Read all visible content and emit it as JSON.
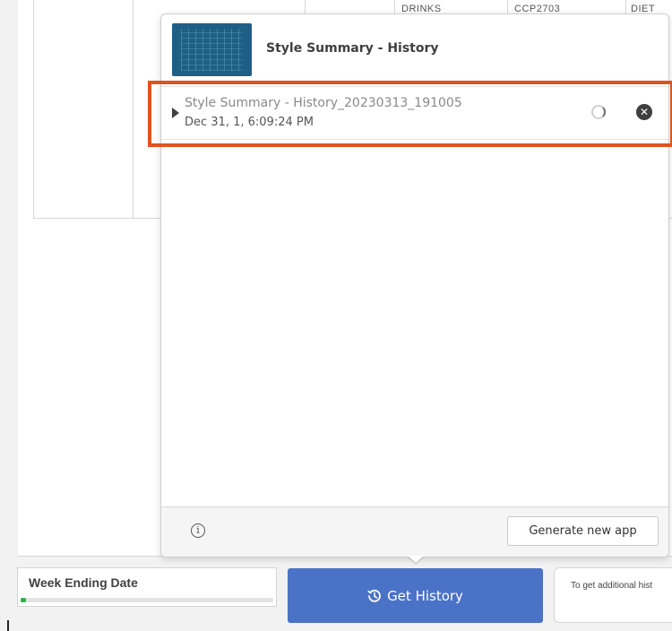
{
  "background_table": {
    "cells": [
      "DRINKS",
      "CCP2703",
      "DIET"
    ]
  },
  "popover": {
    "app_title": "Style Summary - History",
    "history_item": {
      "name": "Style Summary - History_20230313_191005",
      "date": "Dec 31, 1, 6:09:24 PM"
    },
    "footer": {
      "info_icon": "i",
      "generate_label": "Generate new app"
    }
  },
  "bottom_bar": {
    "week_label": "Week Ending Date",
    "week_progress": 0.02,
    "history_button": "Get History",
    "info_text": "To get additional hist"
  },
  "colors": {
    "accent_blue": "#4a72c7",
    "highlight_orange": "#e0531f",
    "progress_green": "#2eaf4a"
  },
  "icons": {
    "history_button_icon": "history-clock-icon",
    "close_icon": "close-circle-icon",
    "info_icon": "info-circle-icon"
  }
}
